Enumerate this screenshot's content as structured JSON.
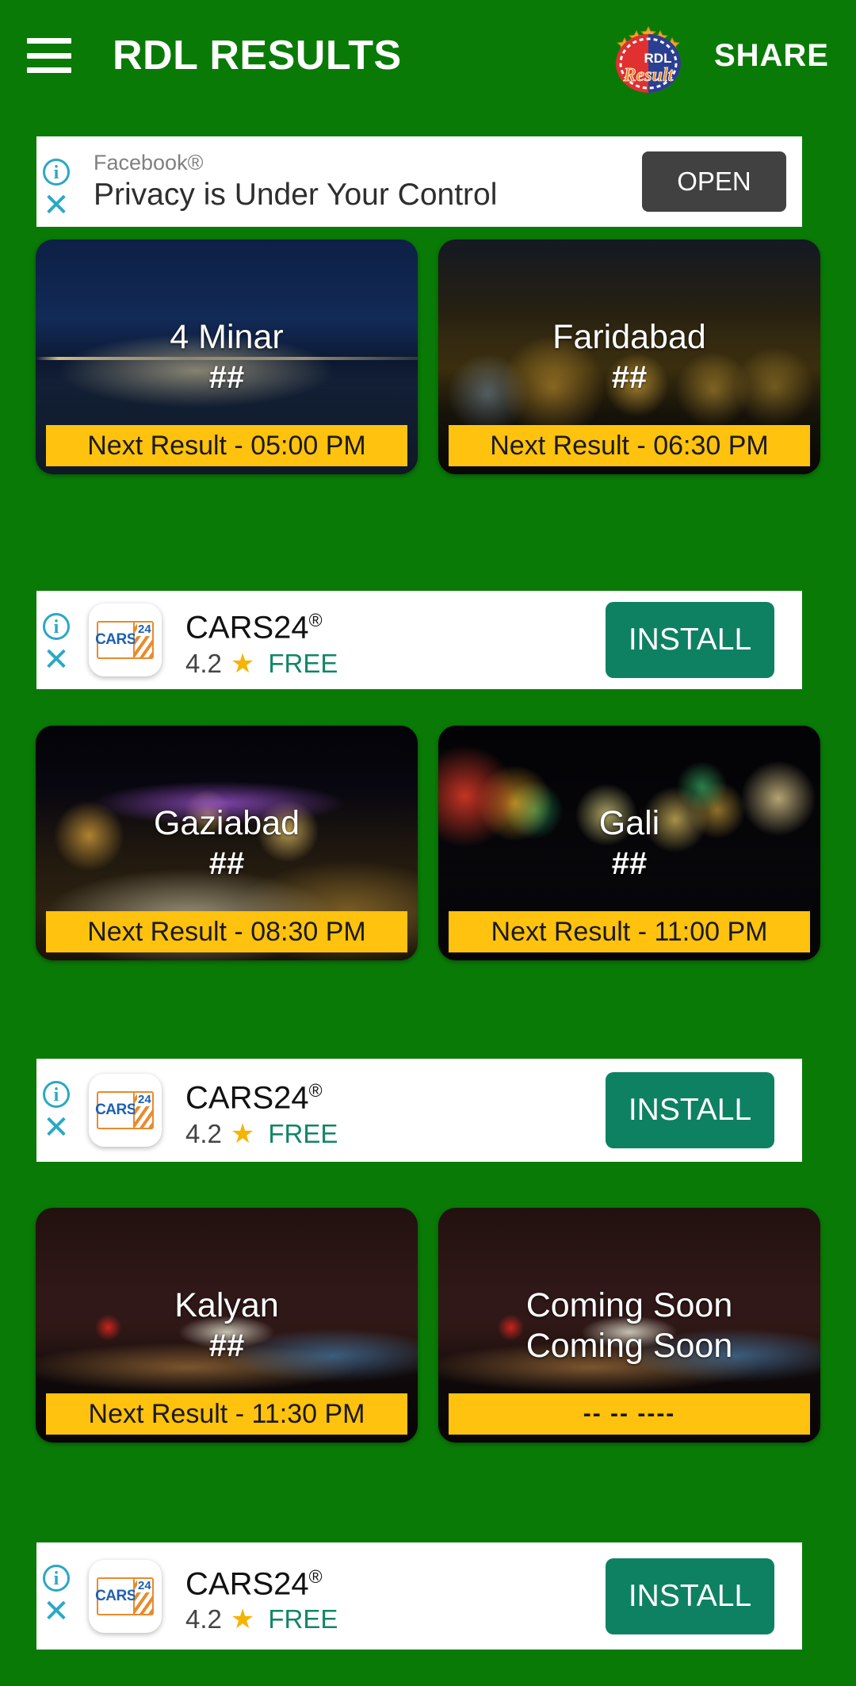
{
  "theme": {
    "background": "#0a7a07",
    "accent_yellow": "#FFC20E",
    "install_green": "#0E8163",
    "open_gray": "#414141"
  },
  "header": {
    "menu_icon": "hamburger-icon",
    "title": "RDL RESULTS",
    "logo_text_top": "RDL",
    "logo_text_bottom": "Result",
    "share_label": "SHARE"
  },
  "facebook_ad": {
    "info_icon": "i",
    "close_icon": "✕",
    "brand": "Facebook®",
    "headline": "Privacy is Under Your Control",
    "cta": "OPEN"
  },
  "cars_ad": {
    "info_icon": "i",
    "close_icon": "✕",
    "icon_left": "CARS",
    "icon_right": "24",
    "title": "CARS24",
    "title_sup": "®",
    "rating": "4.2",
    "star": "★",
    "price": "FREE",
    "cta": "INSTALL"
  },
  "games": [
    {
      "name": "4 Minar",
      "result": "##",
      "next": "Next Result - 05:00 PM",
      "blank": false
    },
    {
      "name": "Faridabad",
      "result": "##",
      "next": "Next Result - 06:30 PM",
      "blank": false
    },
    {
      "name": "Gaziabad",
      "result": "##",
      "next": "Next Result - 08:30 PM",
      "blank": false
    },
    {
      "name": "Gali",
      "result": "##",
      "next": "Next Result - 11:00 PM",
      "blank": false
    },
    {
      "name": "Kalyan",
      "result": "##",
      "next": "Next Result - 11:30 PM",
      "blank": false
    },
    {
      "name": "Coming Soon",
      "result": "Coming Soon",
      "next": "-- -- ----",
      "blank": true
    }
  ]
}
